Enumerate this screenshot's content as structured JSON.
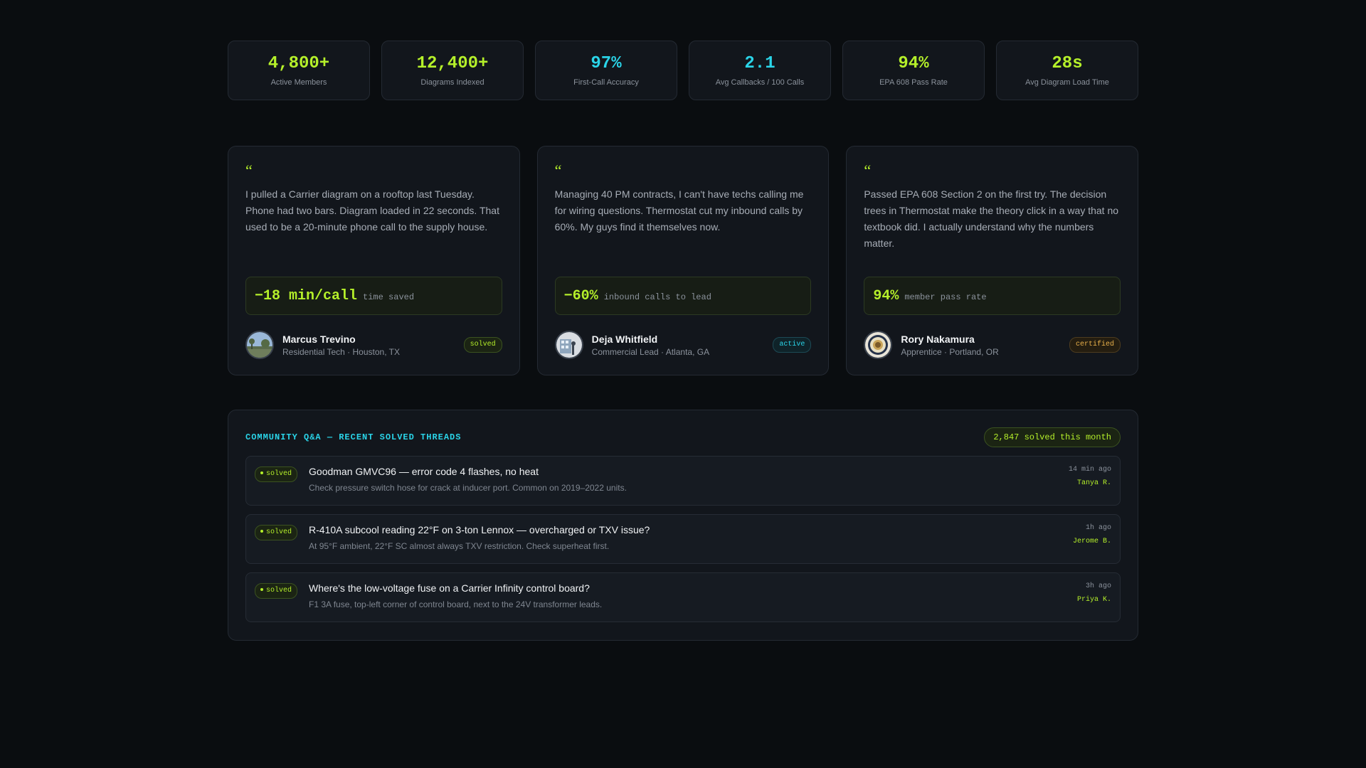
{
  "stats": [
    {
      "value": "4,800+",
      "label": "Active Members",
      "color": "#b5f02a"
    },
    {
      "value": "12,400+",
      "label": "Diagrams Indexed",
      "color": "#b5f02a"
    },
    {
      "value": "97%",
      "label": "First-Call Accuracy",
      "color": "#2ad4e8"
    },
    {
      "value": "2.1",
      "label": "Avg Callbacks / 100 Calls",
      "color": "#2ad4e8"
    },
    {
      "value": "94%",
      "label": "EPA 608 Pass Rate",
      "color": "#b5f02a"
    },
    {
      "value": "28s",
      "label": "Avg Diagram Load Time",
      "color": "#b5f02a"
    }
  ],
  "testimonials": [
    {
      "quote_mark": "“",
      "quote": "I pulled a Carrier diagram on a rooftop last Tuesday. Phone had two bars. Diagram loaded in 22 seconds. That used to be a 20-minute phone call to the supply house.",
      "metric_value": "−18 min/call",
      "metric_label": "time saved",
      "name": "Marcus Trevino",
      "role": "Residential Tech · Houston, TX",
      "badge": "solved",
      "avatar_icon": "landscape-photo-icon"
    },
    {
      "quote_mark": "“",
      "quote": "Managing 40 PM contracts, I can't have techs calling me for wiring questions. Thermostat cut my inbound calls by 60%. My guys find it themselves now.",
      "metric_value": "−60%",
      "metric_label": "inbound calls to lead",
      "name": "Deja Whitfield",
      "role": "Commercial Lead · Atlanta, GA",
      "badge": "active",
      "avatar_icon": "building-photo-icon"
    },
    {
      "quote_mark": "“",
      "quote": "Passed EPA 608 Section 2 on the first try. The decision trees in Thermostat make the theory click in a way that no textbook did. I actually understand why the numbers matter.",
      "metric_value": "94%",
      "metric_label": "member pass rate",
      "name": "Rory Nakamura",
      "role": "Apprentice · Portland, OR",
      "badge": "certified",
      "avatar_icon": "seal-icon"
    }
  ],
  "qa": {
    "title": "COMMUNITY Q&A — RECENT SOLVED THREADS",
    "count": "2,847 solved this month",
    "threads": [
      {
        "badge": "solved",
        "title": "Goodman GMVC96 — error code 4 flashes, no heat",
        "sub": "Check pressure switch hose for crack at inducer port. Common on 2019–2022 units.",
        "time": "14 min ago",
        "user": "Tanya R."
      },
      {
        "badge": "solved",
        "title": "R-410A subcool reading 22°F on 3-ton Lennox — overcharged or TXV issue?",
        "sub": "At 95°F ambient, 22°F SC almost always TXV restriction. Check superheat first.",
        "time": "1h ago",
        "user": "Jerome B."
      },
      {
        "badge": "solved",
        "title": "Where's the low-voltage fuse on a Carrier Infinity control board?",
        "sub": "F1 3A fuse, top-left corner of control board, next to the 24V transformer leads.",
        "time": "3h ago",
        "user": "Priya K."
      }
    ]
  }
}
